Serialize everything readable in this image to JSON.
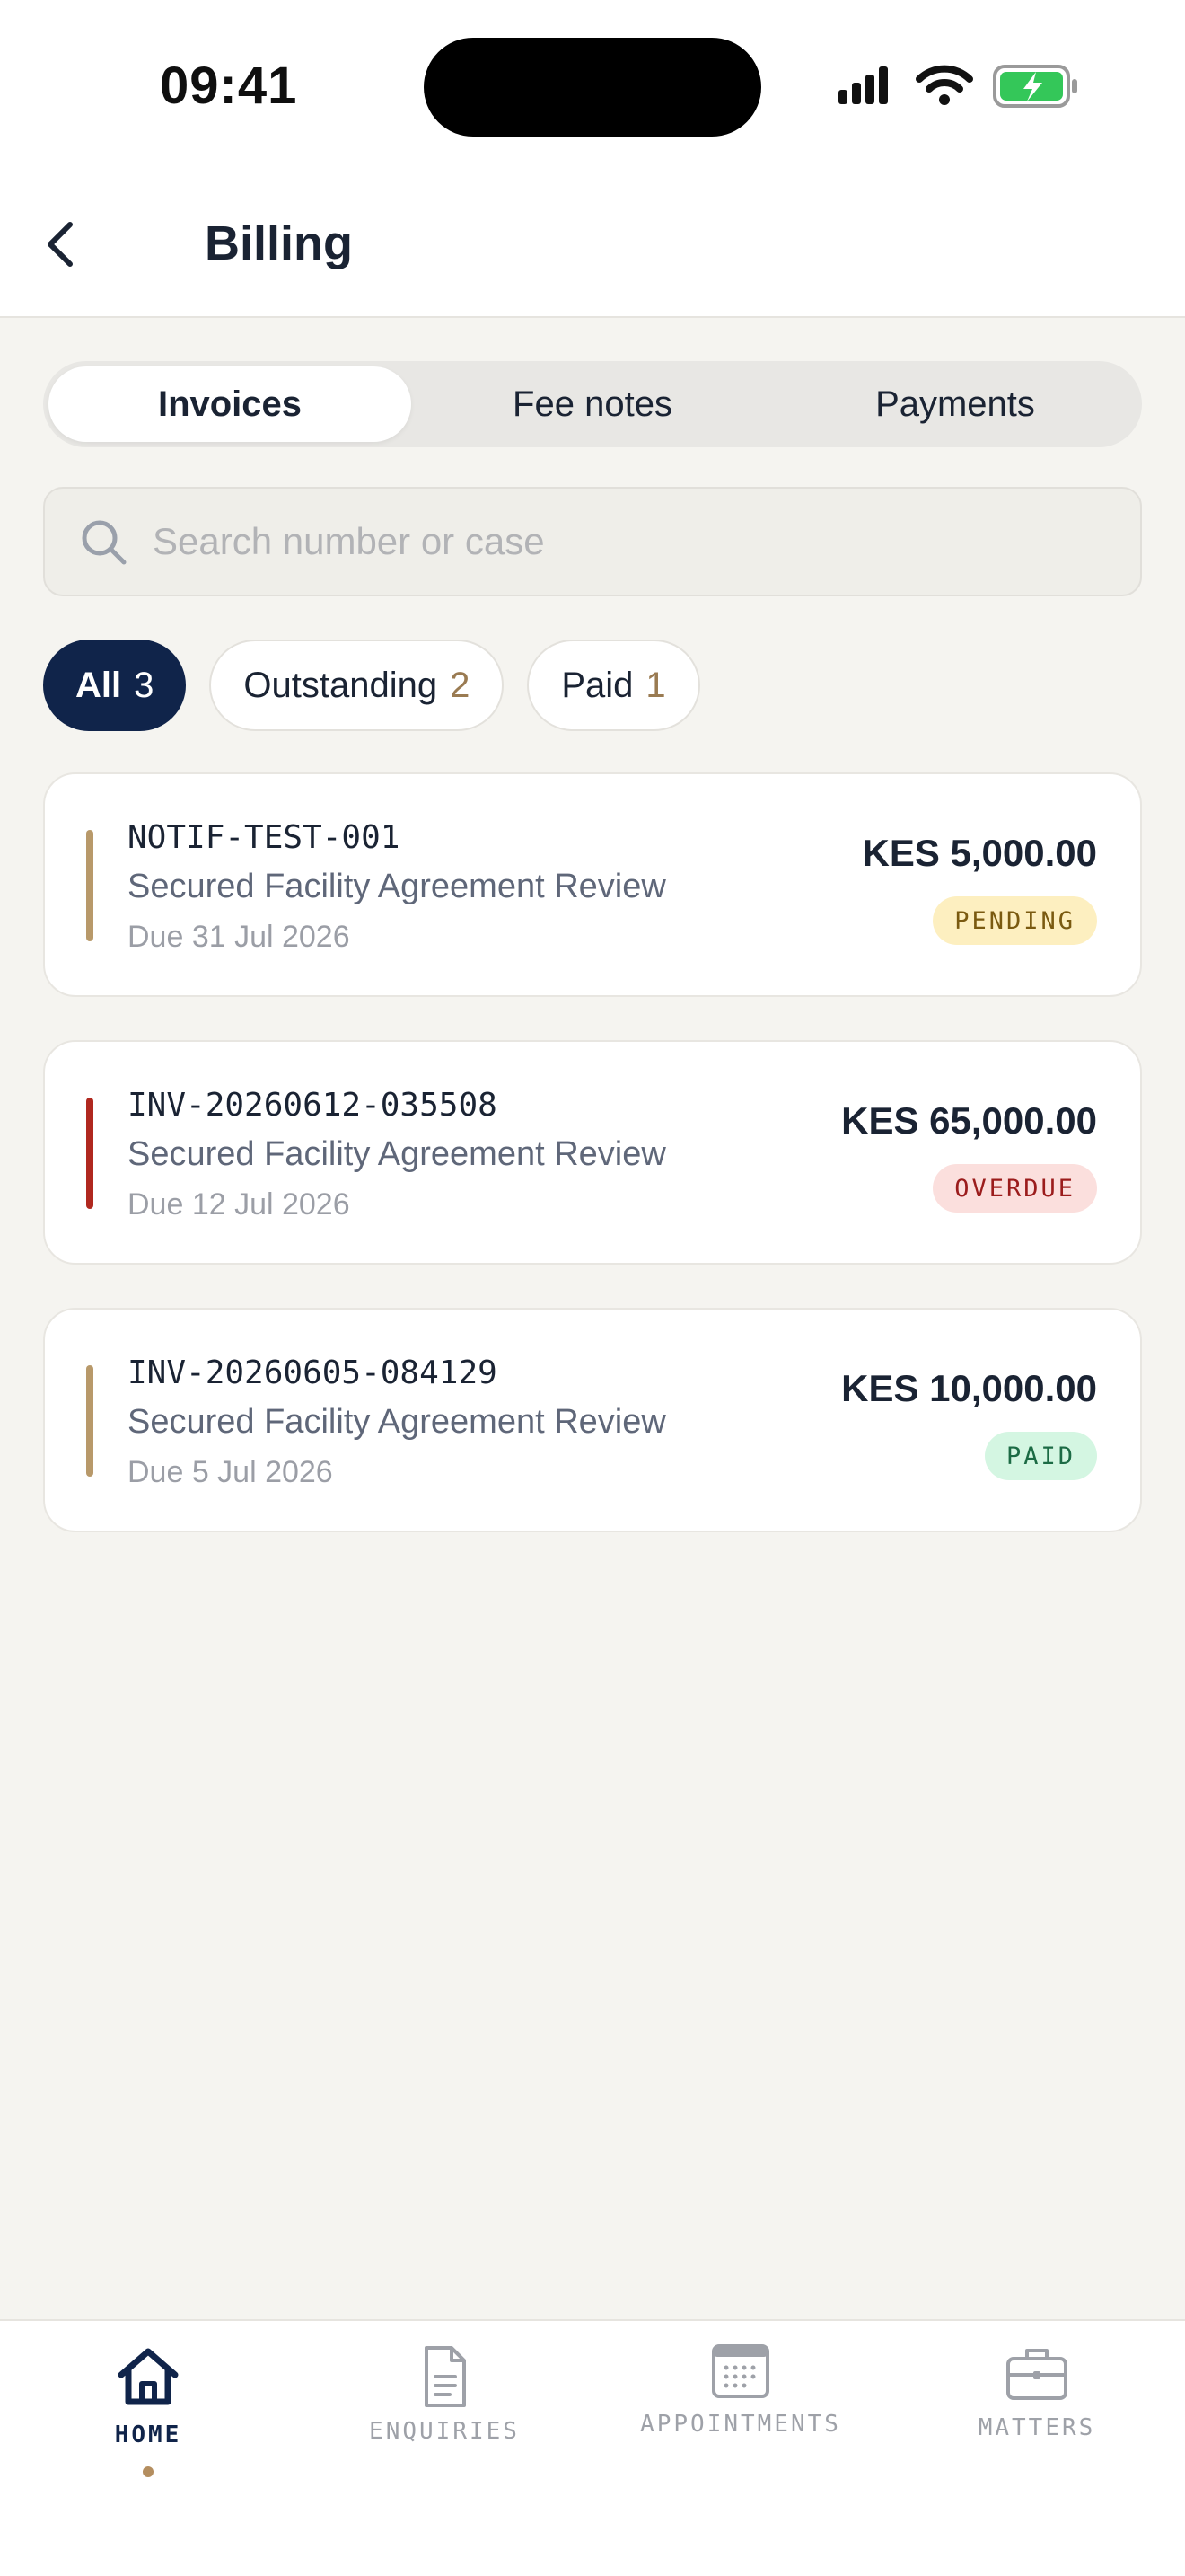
{
  "status_bar": {
    "time": "09:41"
  },
  "header": {
    "title": "Billing",
    "back_icon": "chevron-left-icon"
  },
  "segments": [
    {
      "label": "Invoices",
      "active": true
    },
    {
      "label": "Fee notes",
      "active": false
    },
    {
      "label": "Payments",
      "active": false
    }
  ],
  "search": {
    "placeholder": "Search number or case",
    "value": ""
  },
  "filters": [
    {
      "label": "All",
      "count": "3",
      "active": true
    },
    {
      "label": "Outstanding",
      "count": "2",
      "active": false
    },
    {
      "label": "Paid",
      "count": "1",
      "active": false
    }
  ],
  "invoices": [
    {
      "number": "NOTIF-TEST-001",
      "case": "Secured Facility Agreement Review",
      "due": "Due 31 Jul 2026",
      "amount": "KES 5,000.00",
      "status": "PENDING",
      "accent": "#b8996a",
      "badge_bg": "#fdefc0",
      "badge_fg": "#7a5a10"
    },
    {
      "number": "INV-20260612-035508",
      "case": "Secured Facility Agreement Review",
      "due": "Due 12 Jul 2026",
      "amount": "KES 65,000.00",
      "status": "OVERDUE",
      "accent": "#b0281f",
      "badge_bg": "#fbdfdd",
      "badge_fg": "#9b1c1c"
    },
    {
      "number": "INV-20260605-084129",
      "case": "Secured Facility Agreement Review",
      "due": "Due 5 Jul 2026",
      "amount": "KES 10,000.00",
      "status": "PAID",
      "accent": "#b8996a",
      "badge_bg": "#d4f6e2",
      "badge_fg": "#1c6b45"
    }
  ],
  "tabbar": {
    "home": {
      "label": "HOME",
      "icon": "home-icon",
      "active": true
    },
    "enquiries": {
      "label": "ENQUIRIES",
      "icon": "document-icon"
    },
    "appointments": {
      "label": "APPOINTMENTS",
      "icon": "calendar-icon"
    },
    "matters": {
      "label": "MATTERS",
      "icon": "briefcase-icon"
    }
  },
  "colors": {
    "navy": "#10244a",
    "gold": "#b48e5f",
    "background": "#f5f4f0"
  }
}
